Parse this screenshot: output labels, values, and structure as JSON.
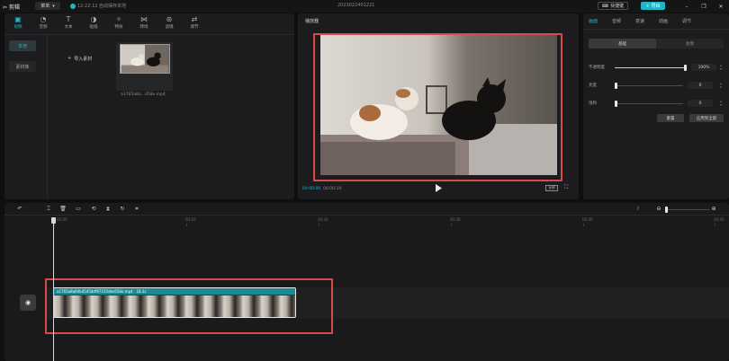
{
  "topbar": {
    "app_name": "剪辑",
    "menu_label": "菜单",
    "save_status": "12:22:12 自动保存本地",
    "doc_title": "2023022401221",
    "shortcut_label": "快捷键",
    "export_label": "导出"
  },
  "media": {
    "tabs": [
      {
        "label": "视频",
        "icon": "media-icon"
      },
      {
        "label": "音频",
        "icon": "audio-icon"
      },
      {
        "label": "文本",
        "icon": "text-icon"
      },
      {
        "label": "贴纸",
        "icon": "sticker-icon"
      },
      {
        "label": "特效",
        "icon": "effects-icon"
      },
      {
        "label": "转场",
        "icon": "transition-icon"
      },
      {
        "label": "滤镜",
        "icon": "filter-icon"
      },
      {
        "label": "调节",
        "icon": "adjust-icon"
      }
    ],
    "side_items": [
      "本地",
      "素材库"
    ],
    "import_label": "导入素材",
    "file_name": "a1765a8a...d58e.mp4"
  },
  "player": {
    "title": "播放器",
    "current_time": "00:00:00",
    "total_time": "00:00:19",
    "ratio_label": "比例"
  },
  "properties": {
    "tabs": [
      "画面",
      "音频",
      "变速",
      "动画",
      "调节"
    ],
    "sub_tabs": [
      "基础",
      "抠像"
    ],
    "rows": [
      {
        "label": "不透明度",
        "value": "100%",
        "level": 1.0
      },
      {
        "label": "亮度",
        "value": "0",
        "level": 0.0
      },
      {
        "label": "饱和",
        "value": "0",
        "level": 0.0
      }
    ],
    "reset_label": "重置",
    "apply_all_label": "应用到全部"
  },
  "timeline": {
    "ruler_labels": [
      "00:00",
      "00:10",
      "00:20",
      "00:30",
      "00:40",
      "00:50"
    ],
    "clip_name": "a1765a8a64b45454df97155dec658e.mp4",
    "clip_duration": "18.2s"
  },
  "colors": {
    "accent": "#1fb7c7",
    "highlight": "#d94b4b",
    "clip": "#124a4e"
  }
}
